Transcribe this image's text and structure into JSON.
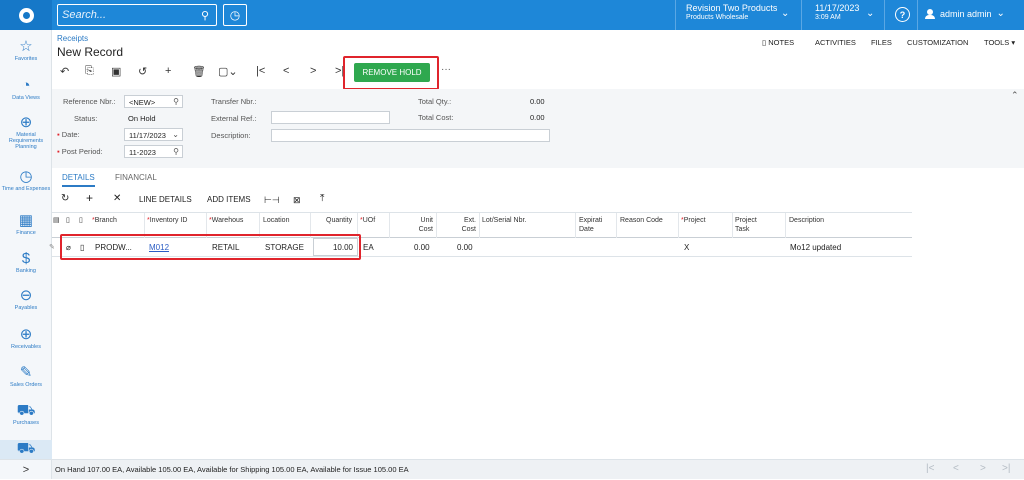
{
  "topbar": {
    "search_placeholder": "Search...",
    "company_name": "Revision Two Products",
    "company_branch": "Products Wholesale",
    "date": "11/17/2023",
    "time": "3:09 AM",
    "help": "?",
    "user": "admin admin"
  },
  "sidebar": {
    "items": [
      {
        "label": "Favorites",
        "icon": "☆"
      },
      {
        "label": "Data Views",
        "icon": "◔"
      },
      {
        "label": "Material Requirements Planning",
        "icon": "⊕"
      },
      {
        "label": "Time and Expenses",
        "icon": "◷"
      },
      {
        "label": "Finance",
        "icon": "▦"
      },
      {
        "label": "Banking",
        "icon": "$"
      },
      {
        "label": "Payables",
        "icon": "⊖"
      },
      {
        "label": "Receivables",
        "icon": "⊕"
      },
      {
        "label": "Sales Orders",
        "icon": "✎"
      },
      {
        "label": "Purchases",
        "icon": "⛟"
      },
      {
        "label": "",
        "icon": "⛟"
      }
    ],
    "more": ">"
  },
  "page": {
    "breadcrumb": "Receipts",
    "title": "New Record",
    "links": {
      "notes": "NOTES",
      "activities": "ACTIVITIES",
      "files": "FILES",
      "customization": "CUSTOMIZATION",
      "tools": "TOOLS ▾"
    },
    "remove_hold": "REMOVE HOLD"
  },
  "form": {
    "ref_label": "Reference Nbr.:",
    "ref_value": "<NEW>",
    "status_label": "Status:",
    "status_value": "On Hold",
    "date_label": "Date:",
    "date_value": "11/17/2023",
    "period_label": "Post Period:",
    "period_value": "11-2023",
    "transfer_label": "Transfer Nbr.:",
    "extref_label": "External Ref.:",
    "desc_label": "Description:",
    "totalqty_label": "Total Qty.:",
    "totalqty_value": "0.00",
    "totalcost_label": "Total Cost:",
    "totalcost_value": "0.00"
  },
  "tabs": {
    "details": "DETAILS",
    "financial": "FINANCIAL"
  },
  "grid_toolbar": {
    "line_details": "LINE DETAILS",
    "add_items": "ADD ITEMS"
  },
  "grid": {
    "headers": {
      "branch": "Branch",
      "inventory": "Inventory ID",
      "warehouse": "Warehous",
      "location": "Location",
      "quantity": "Quantity",
      "uom": "UOf",
      "unit_cost_1": "Unit",
      "unit_cost_2": "Cost",
      "ext_cost_1": "Ext.",
      "ext_cost_2": "Cost",
      "lot": "Lot/Serial Nbr.",
      "exp_1": "Expirati",
      "exp_2": "Date",
      "reason": "Reason Code",
      "project": "Project",
      "task_1": "Project",
      "task_2": "Task",
      "description": "Description"
    },
    "row": {
      "branch": "PRODW...",
      "inventory": "M012",
      "warehouse": "RETAIL",
      "location": "STORAGE",
      "quantity": "10.00",
      "uom": "EA",
      "unit_cost": "0.00",
      "ext_cost": "0.00",
      "project": "X",
      "description": "Mo12 updated"
    }
  },
  "footer": {
    "text": "On Hand 107.00 EA, Available 105.00 EA, Available for Shipping 105.00 EA, Available for Issue 105.00 EA"
  },
  "colors": {
    "topbar": "#1e87d8",
    "accent": "#2c7bc5",
    "highlight": "#e0242c",
    "hold_button": "#2fa84f"
  }
}
